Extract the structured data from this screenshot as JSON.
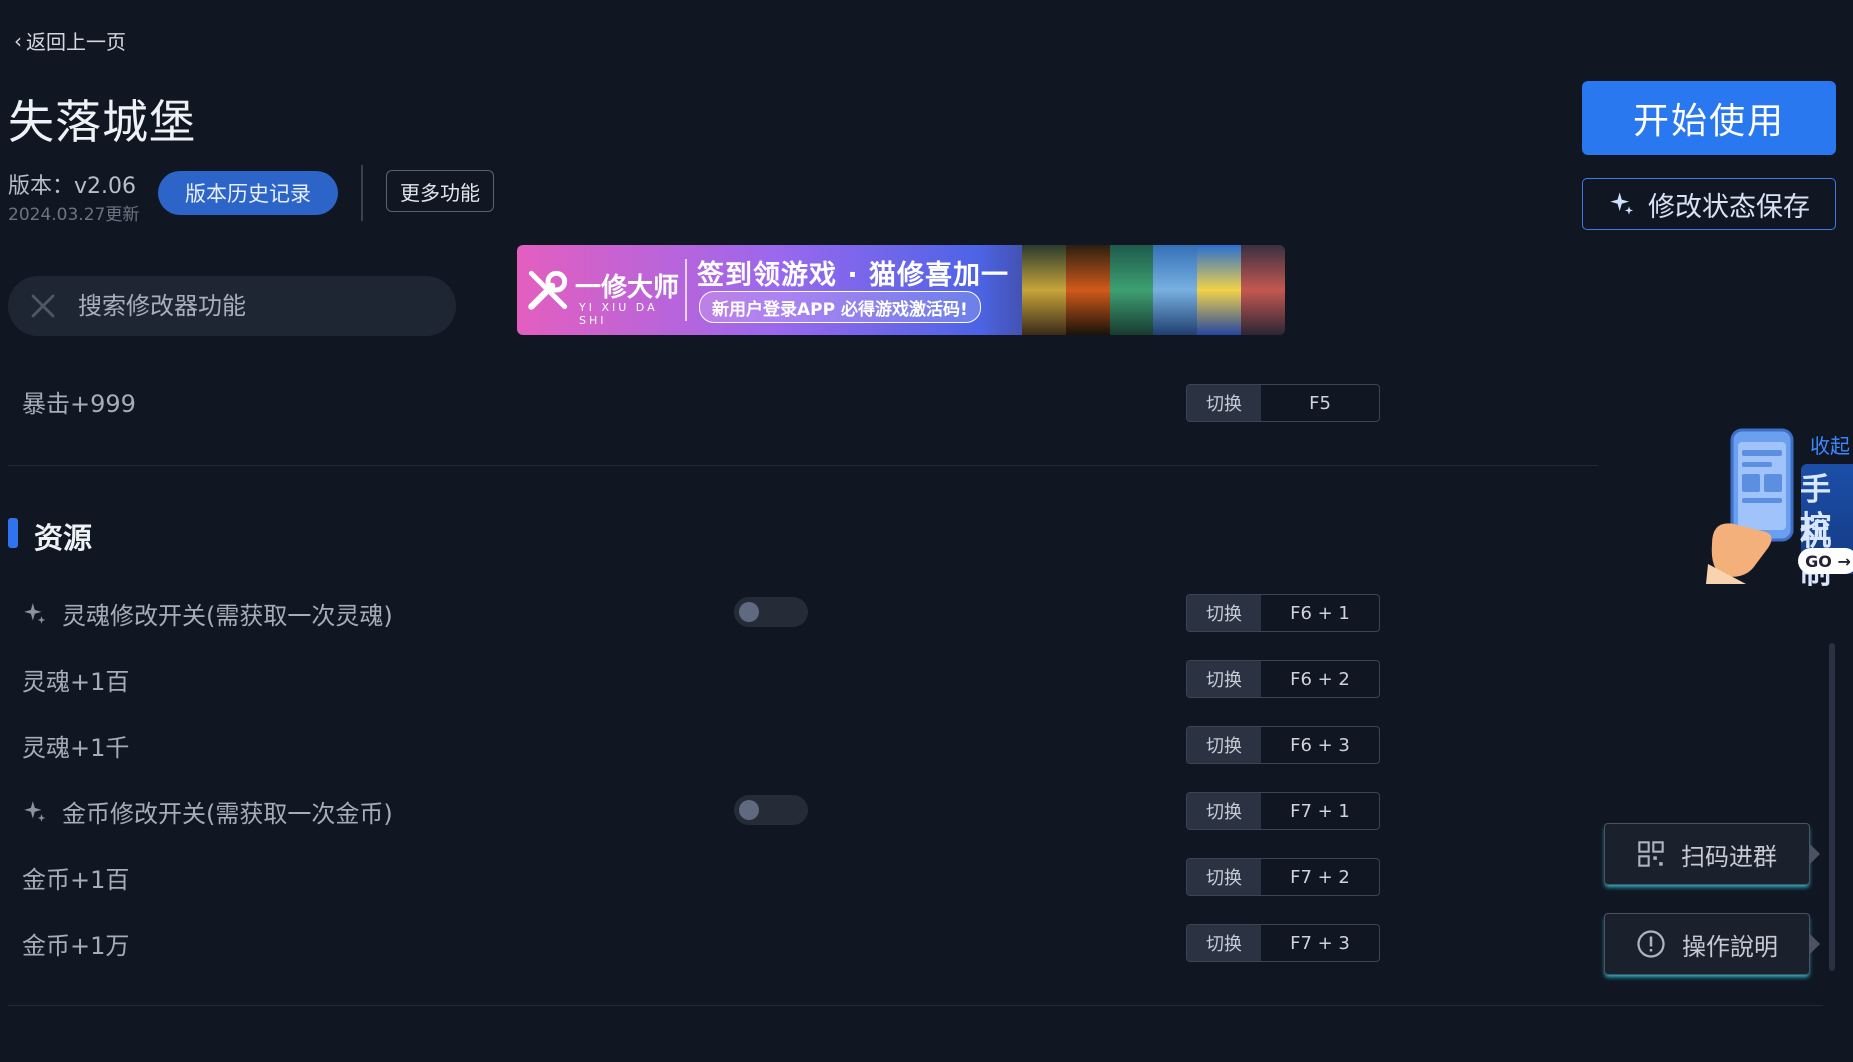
{
  "header": {
    "back_label": "返回上一页",
    "title": "失落城堡",
    "version": "版本：v2.06",
    "update_date": "2024.03.27更新",
    "history_button": "版本历史记录",
    "more_button": "更多功能"
  },
  "actions": {
    "start_button": "开始使用",
    "save_state_button": "修改状态保存"
  },
  "search": {
    "placeholder": "搜索修改器功能",
    "value": ""
  },
  "banner": {
    "brand": "一修大师",
    "brand_sub": "YI XIU DA SHI",
    "headline": "签到领游戏 · 猫修喜加一",
    "pill": "新用户登录APP  必得游戏激活码!"
  },
  "toggle_tag": "切换",
  "top_row": {
    "label": "暴击+999",
    "key": "F5"
  },
  "section": {
    "title": "资源",
    "rows": [
      {
        "label": "灵魂修改开关(需获取一次灵魂)",
        "key": "F6 + 1",
        "has_switch": true,
        "switch_on": false
      },
      {
        "label": "灵魂+1百",
        "key": "F6 + 2",
        "has_switch": false
      },
      {
        "label": "灵魂+1千",
        "key": "F6 + 3",
        "has_switch": false
      },
      {
        "label": "金币修改开关(需获取一次金币)",
        "key": "F7 + 1",
        "has_switch": true,
        "switch_on": false
      },
      {
        "label": "金币+1百",
        "key": "F7 + 2",
        "has_switch": false
      },
      {
        "label": "金币+1万",
        "key": "F7 + 3",
        "has_switch": false
      }
    ]
  },
  "side": {
    "collapse": "收起",
    "phone_line1": "手机",
    "phone_line2": "控制",
    "go": "GO →",
    "qr_button": "扫码进群",
    "guide_button": "操作說明"
  },
  "colors": {
    "background": "#111722",
    "accent": "#2a78f0",
    "history_button": "#2c64c8"
  }
}
